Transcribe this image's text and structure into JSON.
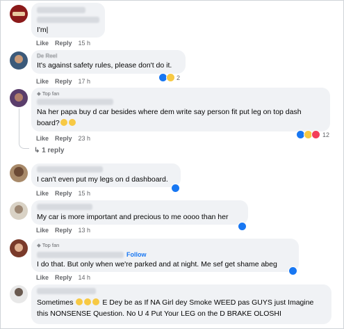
{
  "actions": {
    "like": "Like",
    "reply": "Reply"
  },
  "comments": [
    {
      "text": "I'm|",
      "time": "15 h"
    },
    {
      "name": "De Reel",
      "text": "It's against safety rules, please don't do it.",
      "time": "17 h",
      "reaction_count": "2"
    },
    {
      "badge": "Top fan",
      "text_line1": "Na her papa buy d car besides where dem write say person fit put leg on top dash",
      "text_line2": "board?",
      "time": "23 h",
      "reaction_count": "12",
      "replies": "1 reply"
    },
    {
      "text": "I can't even put my legs on d dashboard.",
      "time": "15 h"
    },
    {
      "text": "My car is more important and precious to me oooo than her",
      "time": "13 h"
    },
    {
      "badge": "Top fan",
      "follow": "Follow",
      "text": "I do that. But only when we're parked and at night. Me sef get shame abeg",
      "time": "14 h"
    },
    {
      "text_line1_a": "Sometimes",
      "text_line1_b": "E Dey be as If NA Girl dey Smoke WEED pas GUYS just Imagine",
      "text_line2": "this NONSENSE Question. No U 4 Put Your LEG on the D BRAKE OLOSHI"
    }
  ]
}
